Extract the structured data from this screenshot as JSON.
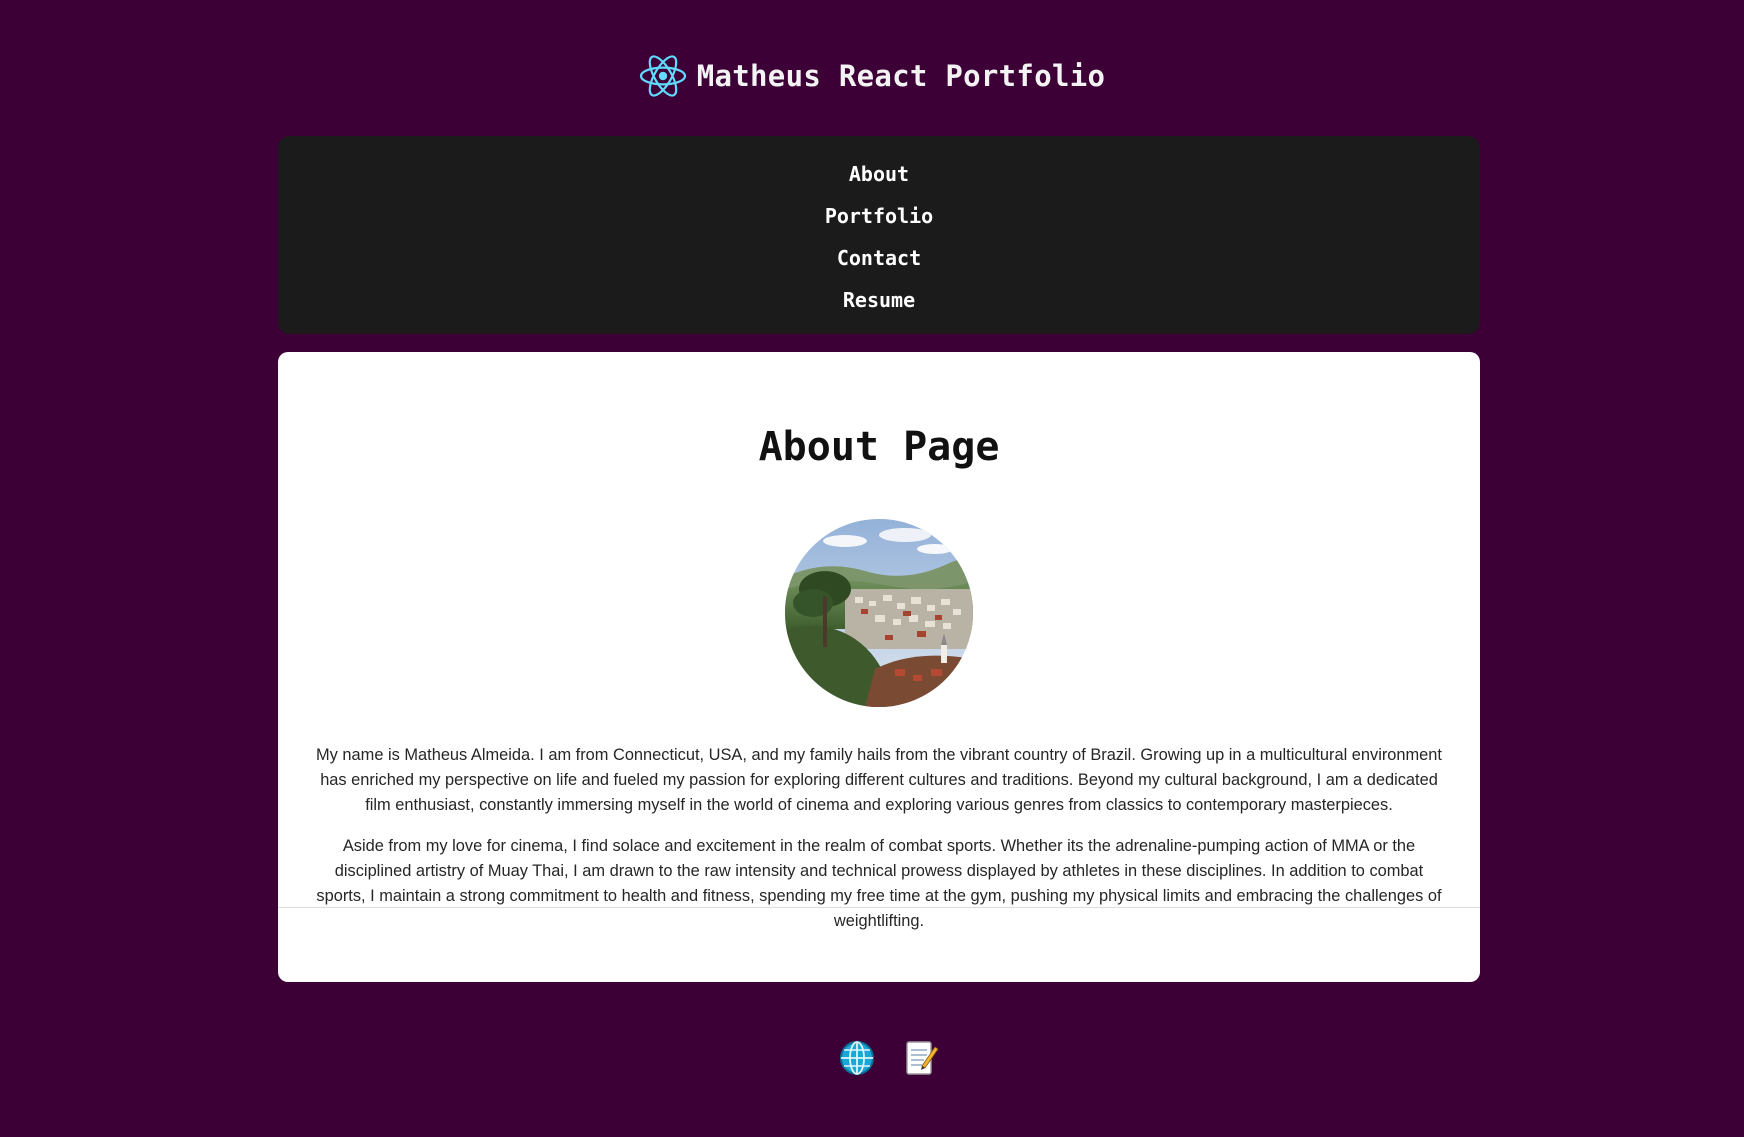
{
  "header": {
    "title": "Matheus React Portfolio",
    "logo_icon": "react-atom-icon",
    "logo_color": "#61dafb"
  },
  "nav": {
    "items": [
      {
        "label": "About"
      },
      {
        "label": "Portfolio"
      },
      {
        "label": "Contact"
      },
      {
        "label": "Resume"
      }
    ]
  },
  "main": {
    "title": "About Page",
    "avatar_icon": "profile-photo-town-landscape",
    "paragraphs": [
      "My name is Matheus Almeida. I am from Connecticut, USA, and my family hails from the vibrant country of Brazil. Growing up in a multicultural environment has enriched my perspective on life and fueled my passion for exploring different cultures and traditions. Beyond my cultural background, I am a dedicated film enthusiast, constantly immersing myself in the world of cinema and exploring various genres from classics to contemporary masterpieces.",
      "Aside from my love for cinema, I find solace and excitement in the realm of combat sports. Whether its the adrenaline-pumping action of MMA or the disciplined artistry of Muay Thai, I am drawn to the raw intensity and technical prowess displayed by athletes in these disciplines. In addition to combat sports, I maintain a strong commitment to health and fitness, spending my free time at the gym, pushing my physical limits and embracing the challenges of weightlifting."
    ]
  },
  "footer": {
    "links": [
      {
        "icon": "globe-icon"
      },
      {
        "icon": "memo-icon"
      }
    ]
  },
  "colors": {
    "page_background": "#3c0037",
    "nav_background": "#1b1b1b",
    "card_background": "#ffffff",
    "title_text": "#f3f3f3"
  }
}
